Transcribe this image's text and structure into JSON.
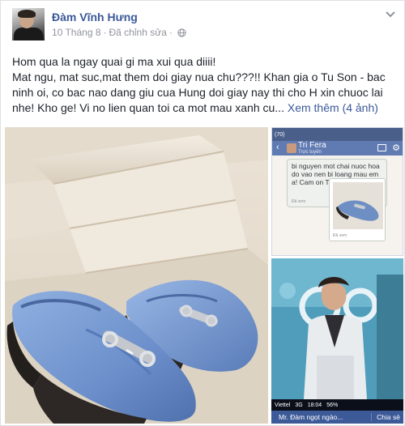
{
  "post": {
    "author": "Đàm Vĩnh Hưng",
    "date": "10 Tháng 8",
    "separator": "·",
    "edited": "Đã chỉnh sửa",
    "lines": [
      "Hom qua la ngay quai gi ma xui qua diiii!",
      "Mat ngu, mat suc,mat them doi giay nua chu???!! Khan gia o Tu Son - bac",
      "ninh oi, co bac nao dang giu cua Hung doi giay nay thi cho H xin chuoc lai",
      "nhe! Kho ge! Vi no lien quan toi ca mot mau xanh cu..."
    ],
    "see_more": "Xem thêm",
    "photo_count": "(4 ảnh)"
  },
  "thumb_chat": {
    "status_left": "(70)",
    "contact_name": "Tri Fera",
    "contact_status": "Trực tuyến",
    "back_glyph": "‹",
    "gear_glyph": "⚙",
    "message": "bi nguyen mot chai nuoc hoa do vao nen bi loang mau em a! Cam on Tri",
    "message_time": "Đã xem"
  },
  "thumb_screen": {
    "carrier": "Viettel",
    "network": "3G",
    "time": "18:04",
    "battery": "56%",
    "chat_title": "Mr. Đàm ngọt ngào...",
    "share_label": "Chia sẻ"
  },
  "icons": {
    "globe": "globe-icon",
    "chevron": "chevron-down-icon"
  },
  "colors": {
    "link": "#3b5998",
    "text": "#1d2129",
    "meta": "#90949c",
    "shoe": "#6e8fc4"
  }
}
